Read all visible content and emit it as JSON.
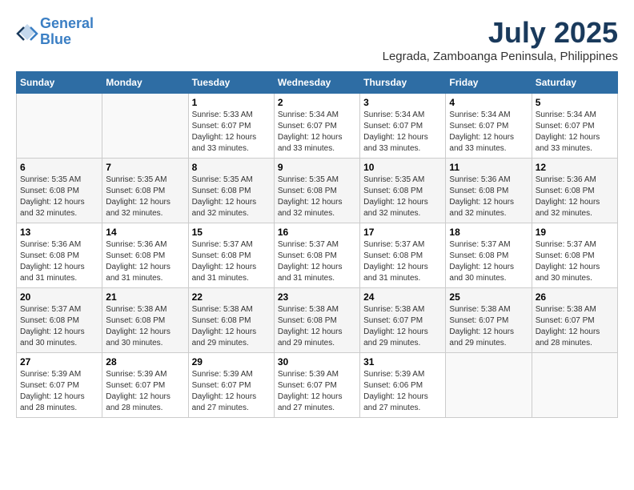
{
  "header": {
    "logo_line1": "General",
    "logo_line2": "Blue",
    "month_year": "July 2025",
    "location": "Legrada, Zamboanga Peninsula, Philippines"
  },
  "weekdays": [
    "Sunday",
    "Monday",
    "Tuesday",
    "Wednesday",
    "Thursday",
    "Friday",
    "Saturday"
  ],
  "weeks": [
    [
      {
        "day": "",
        "info": ""
      },
      {
        "day": "",
        "info": ""
      },
      {
        "day": "1",
        "info": "Sunrise: 5:33 AM\nSunset: 6:07 PM\nDaylight: 12 hours\nand 33 minutes."
      },
      {
        "day": "2",
        "info": "Sunrise: 5:34 AM\nSunset: 6:07 PM\nDaylight: 12 hours\nand 33 minutes."
      },
      {
        "day": "3",
        "info": "Sunrise: 5:34 AM\nSunset: 6:07 PM\nDaylight: 12 hours\nand 33 minutes."
      },
      {
        "day": "4",
        "info": "Sunrise: 5:34 AM\nSunset: 6:07 PM\nDaylight: 12 hours\nand 33 minutes."
      },
      {
        "day": "5",
        "info": "Sunrise: 5:34 AM\nSunset: 6:07 PM\nDaylight: 12 hours\nand 33 minutes."
      }
    ],
    [
      {
        "day": "6",
        "info": "Sunrise: 5:35 AM\nSunset: 6:08 PM\nDaylight: 12 hours\nand 32 minutes."
      },
      {
        "day": "7",
        "info": "Sunrise: 5:35 AM\nSunset: 6:08 PM\nDaylight: 12 hours\nand 32 minutes."
      },
      {
        "day": "8",
        "info": "Sunrise: 5:35 AM\nSunset: 6:08 PM\nDaylight: 12 hours\nand 32 minutes."
      },
      {
        "day": "9",
        "info": "Sunrise: 5:35 AM\nSunset: 6:08 PM\nDaylight: 12 hours\nand 32 minutes."
      },
      {
        "day": "10",
        "info": "Sunrise: 5:35 AM\nSunset: 6:08 PM\nDaylight: 12 hours\nand 32 minutes."
      },
      {
        "day": "11",
        "info": "Sunrise: 5:36 AM\nSunset: 6:08 PM\nDaylight: 12 hours\nand 32 minutes."
      },
      {
        "day": "12",
        "info": "Sunrise: 5:36 AM\nSunset: 6:08 PM\nDaylight: 12 hours\nand 32 minutes."
      }
    ],
    [
      {
        "day": "13",
        "info": "Sunrise: 5:36 AM\nSunset: 6:08 PM\nDaylight: 12 hours\nand 31 minutes."
      },
      {
        "day": "14",
        "info": "Sunrise: 5:36 AM\nSunset: 6:08 PM\nDaylight: 12 hours\nand 31 minutes."
      },
      {
        "day": "15",
        "info": "Sunrise: 5:37 AM\nSunset: 6:08 PM\nDaylight: 12 hours\nand 31 minutes."
      },
      {
        "day": "16",
        "info": "Sunrise: 5:37 AM\nSunset: 6:08 PM\nDaylight: 12 hours\nand 31 minutes."
      },
      {
        "day": "17",
        "info": "Sunrise: 5:37 AM\nSunset: 6:08 PM\nDaylight: 12 hours\nand 31 minutes."
      },
      {
        "day": "18",
        "info": "Sunrise: 5:37 AM\nSunset: 6:08 PM\nDaylight: 12 hours\nand 30 minutes."
      },
      {
        "day": "19",
        "info": "Sunrise: 5:37 AM\nSunset: 6:08 PM\nDaylight: 12 hours\nand 30 minutes."
      }
    ],
    [
      {
        "day": "20",
        "info": "Sunrise: 5:37 AM\nSunset: 6:08 PM\nDaylight: 12 hours\nand 30 minutes."
      },
      {
        "day": "21",
        "info": "Sunrise: 5:38 AM\nSunset: 6:08 PM\nDaylight: 12 hours\nand 30 minutes."
      },
      {
        "day": "22",
        "info": "Sunrise: 5:38 AM\nSunset: 6:08 PM\nDaylight: 12 hours\nand 29 minutes."
      },
      {
        "day": "23",
        "info": "Sunrise: 5:38 AM\nSunset: 6:08 PM\nDaylight: 12 hours\nand 29 minutes."
      },
      {
        "day": "24",
        "info": "Sunrise: 5:38 AM\nSunset: 6:07 PM\nDaylight: 12 hours\nand 29 minutes."
      },
      {
        "day": "25",
        "info": "Sunrise: 5:38 AM\nSunset: 6:07 PM\nDaylight: 12 hours\nand 29 minutes."
      },
      {
        "day": "26",
        "info": "Sunrise: 5:38 AM\nSunset: 6:07 PM\nDaylight: 12 hours\nand 28 minutes."
      }
    ],
    [
      {
        "day": "27",
        "info": "Sunrise: 5:39 AM\nSunset: 6:07 PM\nDaylight: 12 hours\nand 28 minutes."
      },
      {
        "day": "28",
        "info": "Sunrise: 5:39 AM\nSunset: 6:07 PM\nDaylight: 12 hours\nand 28 minutes."
      },
      {
        "day": "29",
        "info": "Sunrise: 5:39 AM\nSunset: 6:07 PM\nDaylight: 12 hours\nand 27 minutes."
      },
      {
        "day": "30",
        "info": "Sunrise: 5:39 AM\nSunset: 6:07 PM\nDaylight: 12 hours\nand 27 minutes."
      },
      {
        "day": "31",
        "info": "Sunrise: 5:39 AM\nSunset: 6:06 PM\nDaylight: 12 hours\nand 27 minutes."
      },
      {
        "day": "",
        "info": ""
      },
      {
        "day": "",
        "info": ""
      }
    ]
  ]
}
